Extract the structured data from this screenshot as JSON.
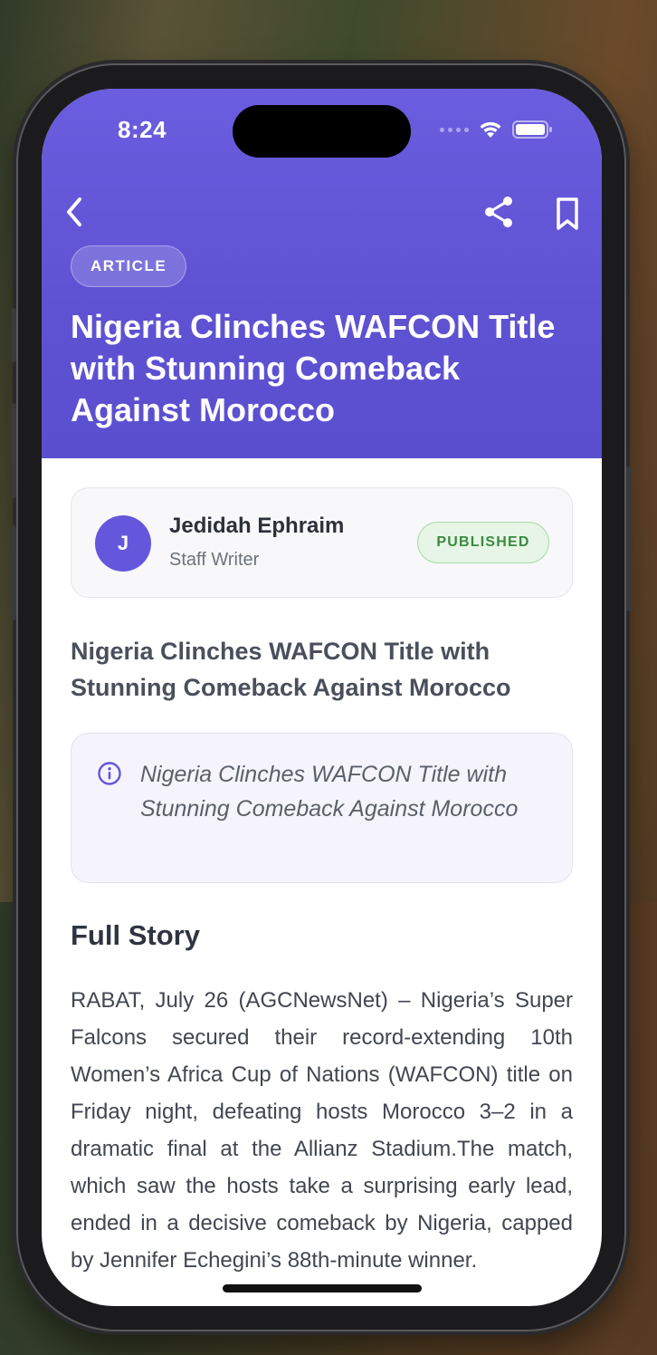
{
  "status_bar": {
    "time": "8:24"
  },
  "header": {
    "category": "ARTICLE",
    "title": "Nigeria Clinches WAFCON Title with Stunning Comeback Against Morocco",
    "icons": [
      "back-icon",
      "share-icon",
      "bookmark-icon"
    ]
  },
  "author": {
    "initial": "J",
    "name": "Jedidah Ephraim",
    "role": "Staff Writer",
    "status": "PUBLISHED"
  },
  "subtitle": "Nigeria Clinches WAFCON Title with Stunning Comeback Against Morocco",
  "summary": "Nigeria Clinches WAFCON Title with Stunning Comeback Against Morocco",
  "story": {
    "heading": "Full Story",
    "body": "RABAT, July 26 (AGCNewsNet) – Nigeria’s Super Falcons secured their record-extending 10th Women’s Africa Cup of Nations (WAFCON) title on Friday night, defeating hosts Morocco 3–2 in a dramatic final at the Allianz Stadium.The match, which saw the hosts take a surprising early lead, ended in a decisive comeback by Nigeria, capped by Jennifer Echegini’s 88th-minute winner."
  },
  "colors": {
    "header_bg": "#6a5ddf",
    "accent": "#6457dc",
    "published_green": "#3b8a3f"
  }
}
